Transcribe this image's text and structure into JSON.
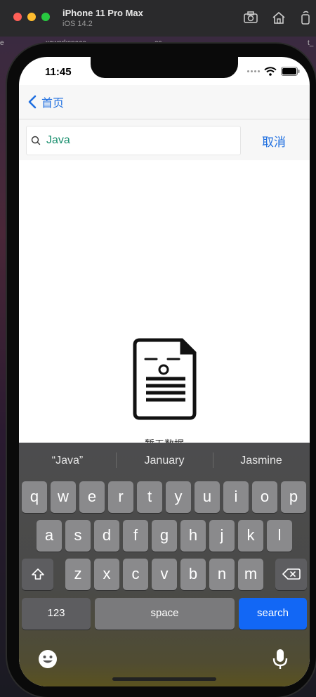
{
  "simulator": {
    "device": "iPhone 11 Pro Max",
    "os": "iOS 14.2",
    "bg_left_text": "e",
    "bg_mid_text": "xcworkspace",
    "bg_mid2_text": "es",
    "bg_right_text": "t_"
  },
  "status": {
    "time": "11:45"
  },
  "nav": {
    "back_label": "首页"
  },
  "search": {
    "value": "Java",
    "placeholder": "",
    "cancel_label": "取消"
  },
  "empty_state": {
    "message": "暂无数据"
  },
  "keyboard": {
    "suggestions": [
      "“Java”",
      "January",
      "Jasmine"
    ],
    "row1": [
      "q",
      "w",
      "e",
      "r",
      "t",
      "y",
      "u",
      "i",
      "o",
      "p"
    ],
    "row2": [
      "a",
      "s",
      "d",
      "f",
      "g",
      "h",
      "j",
      "k",
      "l"
    ],
    "row3": [
      "z",
      "x",
      "c",
      "v",
      "b",
      "n",
      "m"
    ],
    "numbers_label": "123",
    "space_label": "space",
    "search_label": "search"
  },
  "colors": {
    "accent": "#1f6fe0",
    "search_key": "#1267f5"
  }
}
